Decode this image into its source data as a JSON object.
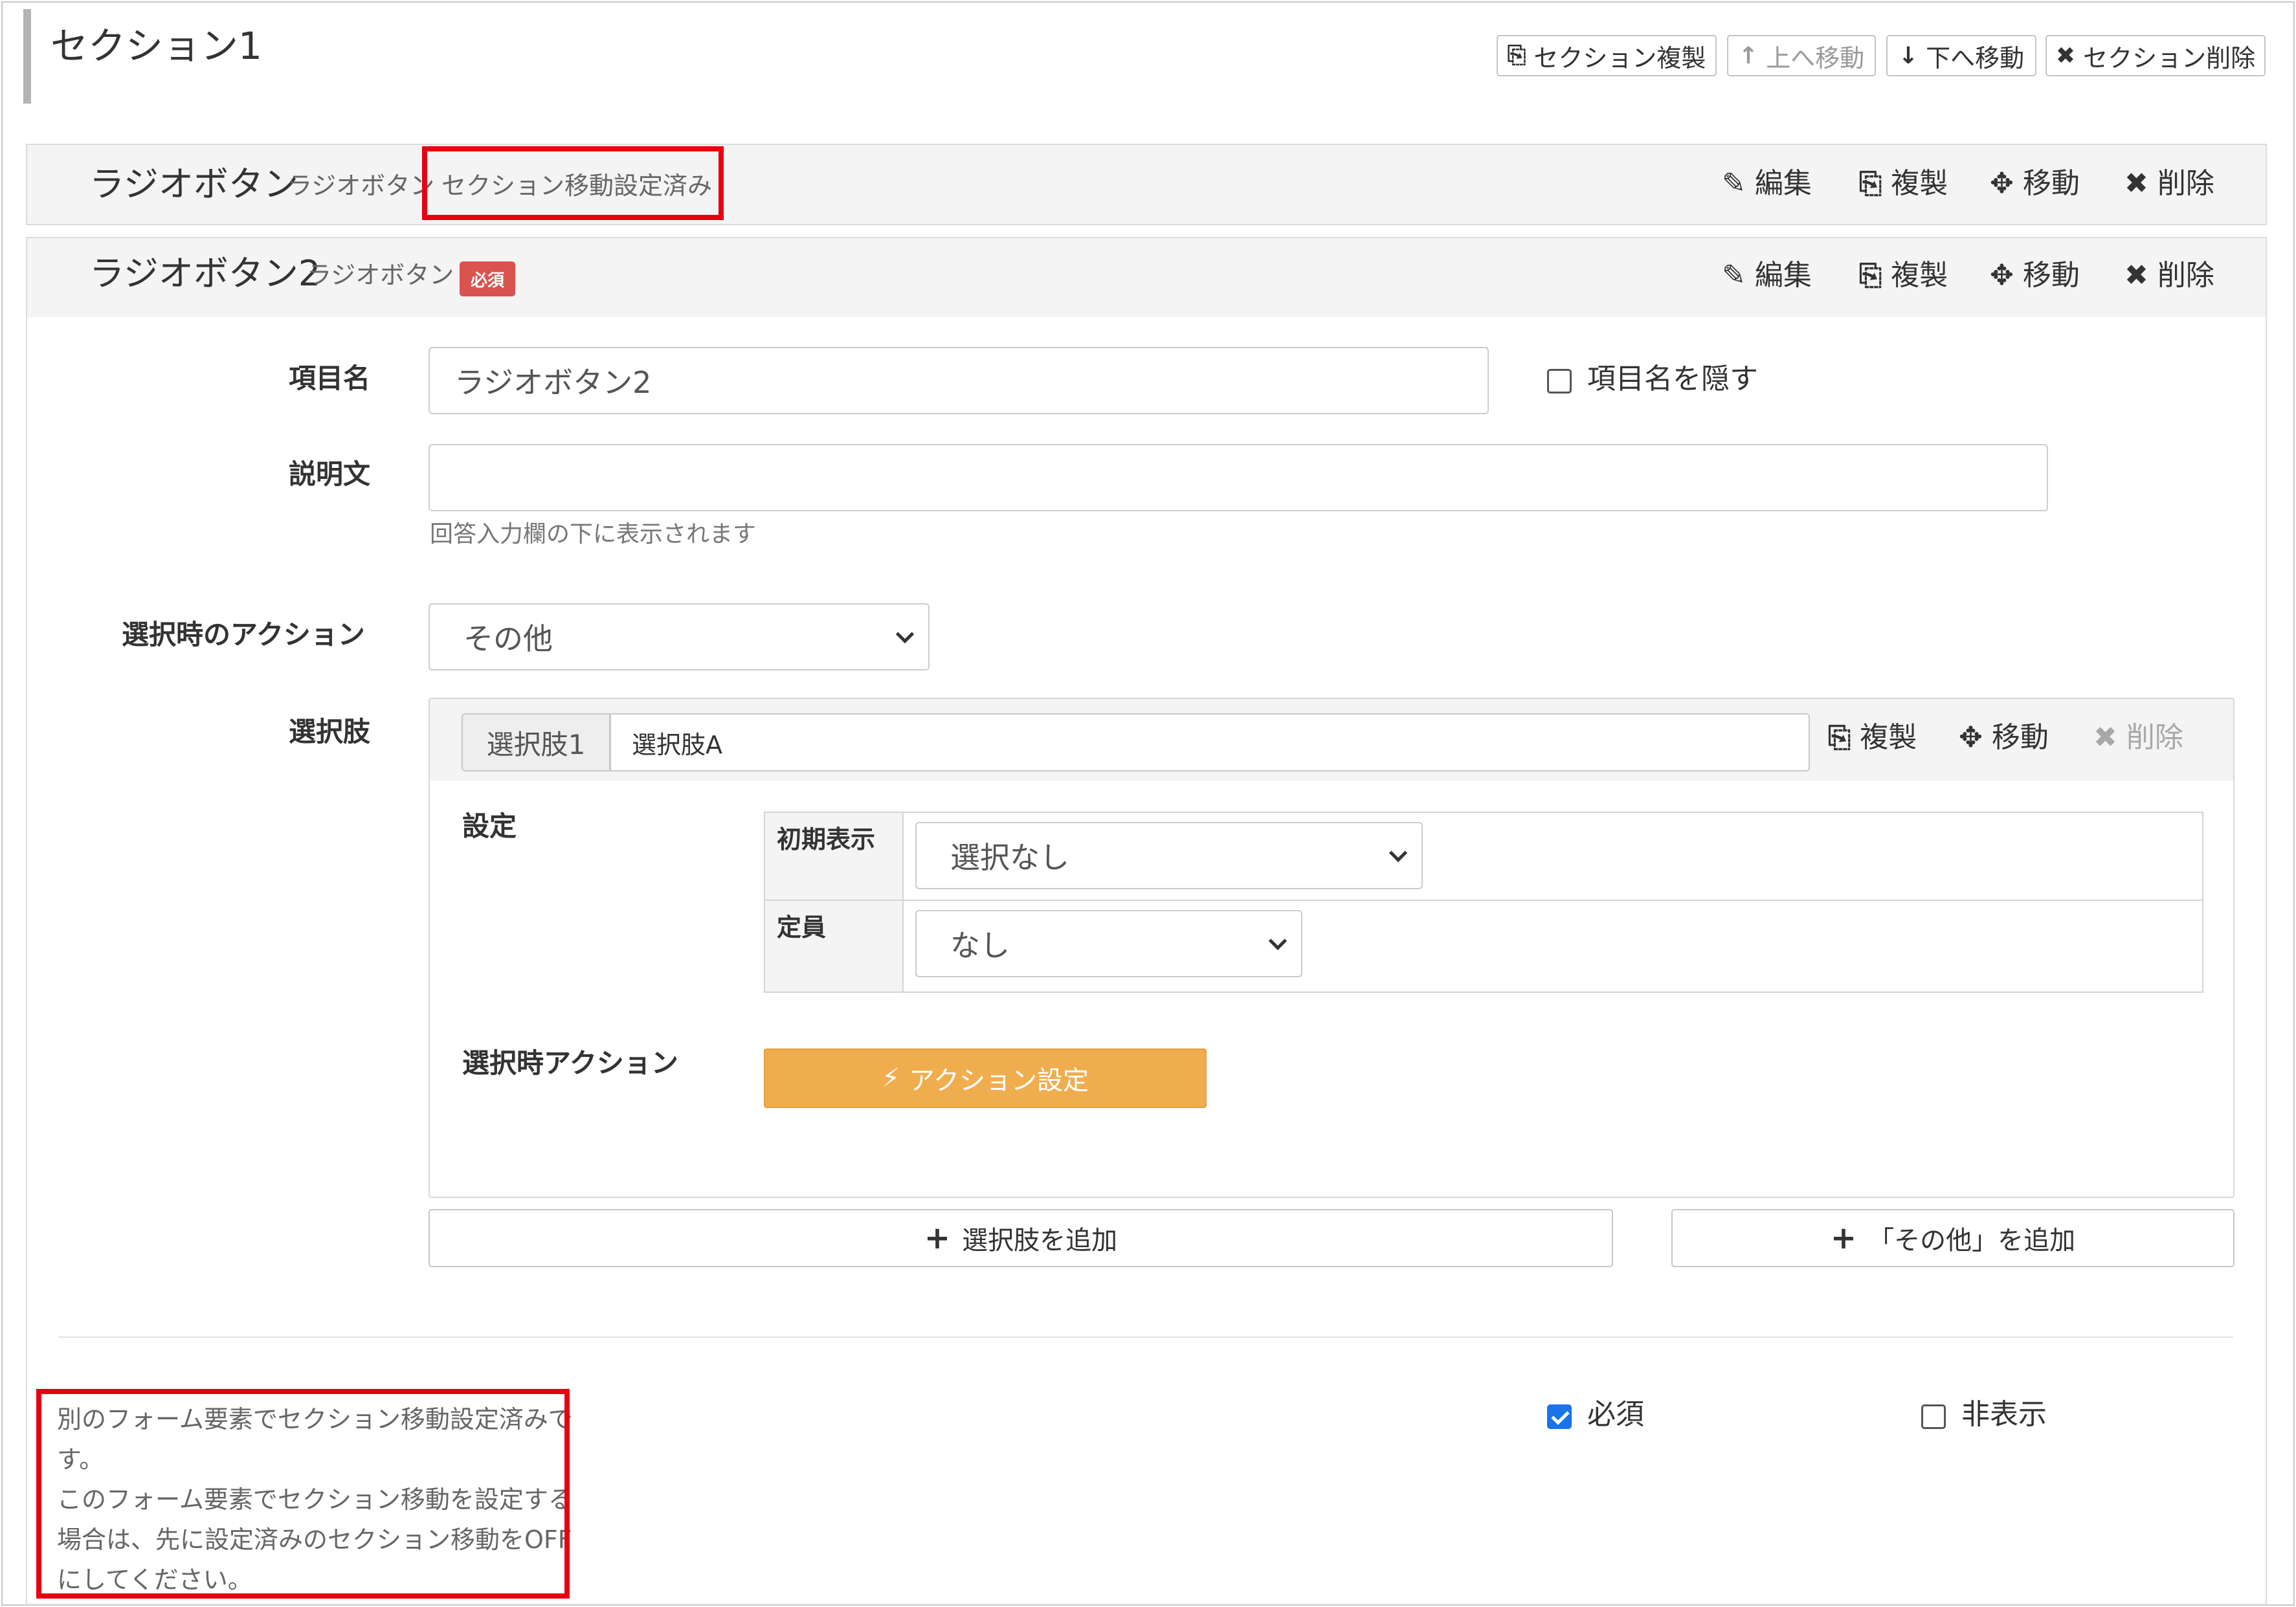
{
  "section": {
    "title": "セクション1",
    "buttons": {
      "duplicate": "セクション複製",
      "move_up": "上へ移動",
      "move_down": "下へ移動",
      "delete": "セクション削除"
    }
  },
  "item1": {
    "name": "ラジオボタン",
    "type": "ラジオボタン",
    "notice": "セクション移動設定済み",
    "actions": {
      "edit": "編集",
      "duplicate": "複製",
      "move": "移動",
      "delete": "削除"
    }
  },
  "item2": {
    "name": "ラジオボタン2",
    "type": "ラジオボタン",
    "required_badge": "必須",
    "actions": {
      "edit": "編集",
      "duplicate": "複製",
      "move": "移動",
      "delete": "削除"
    }
  },
  "form": {
    "item_name_label": "項目名",
    "item_name_value": "ラジオボタン2",
    "hide_name_label": "項目名を隠す",
    "hide_name_checked": false,
    "description_label": "説明文",
    "description_value": "",
    "description_help": "回答入力欄の下に表示されます",
    "select_action_label": "選択時のアクション",
    "select_action_value": "その他",
    "choices_label": "選択肢"
  },
  "choice": {
    "addon": "選択肢1",
    "value": "選択肢A",
    "actions": {
      "duplicate": "複製",
      "move": "移動",
      "delete": "削除"
    },
    "settings_label": "設定",
    "initial_display_label": "初期表示",
    "initial_display_value": "選択なし",
    "capacity_label": "定員",
    "capacity_value": "なし",
    "on_select_action_label": "選択時アクション",
    "action_settings_button": "アクション設定",
    "action_button_color": "#f0ad4e"
  },
  "add_buttons": {
    "add_choice": "選択肢を追加",
    "add_other": "「その他」を追加"
  },
  "footer": {
    "required_label": "必須",
    "required_checked": true,
    "hidden_label": "非表示",
    "hidden_checked": false,
    "note_lines": [
      "別のフォーム要素でセクション移動設定済みで",
      "す。",
      "このフォーム要素でセクション移動を設定する",
      "場合は、先に設定済みのセクション移動をOFF",
      "にしてください。"
    ]
  },
  "colors": {
    "highlight": "#e60012",
    "required_badge": "#d9534f",
    "checkbox_checked": "#1a73e8"
  }
}
